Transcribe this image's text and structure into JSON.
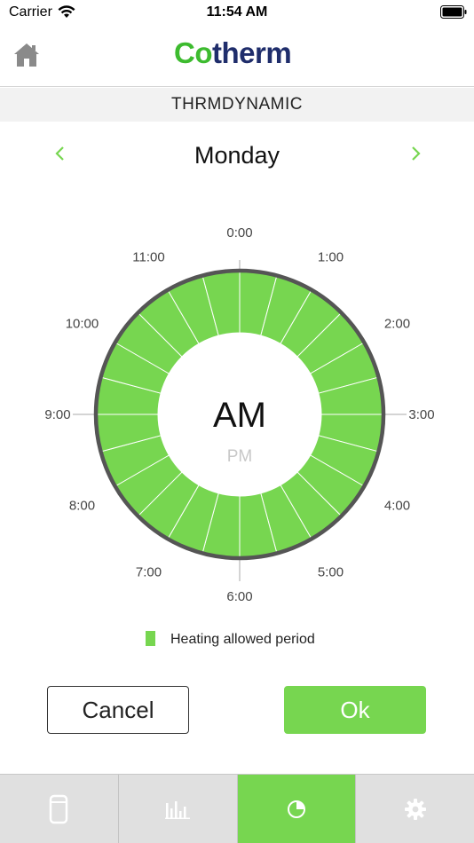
{
  "status": {
    "carrier": "Carrier",
    "time": "11:54 AM"
  },
  "header": {
    "logo_prefix": "Co",
    "logo_suffix": "therm"
  },
  "device": {
    "name": "THRMDYNAMIC"
  },
  "day_nav": {
    "day": "Monday"
  },
  "clock": {
    "center_primary": "AM",
    "center_secondary": "PM",
    "hour_labels": [
      "0:00",
      "1:00",
      "2:00",
      "3:00",
      "4:00",
      "5:00",
      "6:00",
      "7:00",
      "8:00",
      "9:00",
      "10:00",
      "11:00"
    ],
    "segments_per_half_day": 24,
    "heating_allowed": [
      true,
      true,
      true,
      true,
      true,
      true,
      true,
      true,
      true,
      true,
      true,
      true,
      true,
      true,
      true,
      true,
      true,
      true,
      true,
      true,
      true,
      true,
      true,
      true
    ]
  },
  "legend": {
    "label": "Heating allowed period"
  },
  "buttons": {
    "cancel": "Cancel",
    "ok": "Ok"
  },
  "colors": {
    "accent": "#77d650",
    "ring": "#555555",
    "logo_green": "#3dbb2f",
    "logo_navy": "#1f2d6b"
  },
  "tabs": [
    {
      "icon": "device-icon",
      "active": false
    },
    {
      "icon": "bar-chart-icon",
      "active": false
    },
    {
      "icon": "pie-chart-icon",
      "active": true
    },
    {
      "icon": "gear-icon",
      "active": false
    }
  ]
}
